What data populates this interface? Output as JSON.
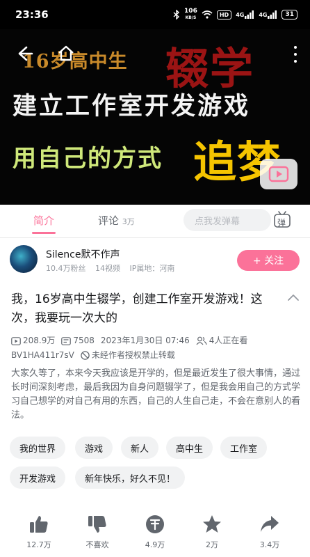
{
  "status_bar": {
    "time": "23:36",
    "net_speed": "106",
    "net_unit": "KB/S",
    "hd_badge": "HD",
    "signal1": "4G",
    "signal2": "4G",
    "battery": "31"
  },
  "video": {
    "line1": "16岁高中生",
    "big1": "辍学",
    "line2": "建立工作室开发游戏",
    "line3": "用自己的方式",
    "big2": "追梦",
    "colors": {
      "gold": "#c98a2a",
      "red": "#9b1414",
      "lime": "#cfe87a",
      "yellow": "#f5c400"
    }
  },
  "tabs": {
    "intro_label": "简介",
    "comments_label": "评论",
    "comments_count": "3万",
    "danmaku_placeholder": "点我发弹幕",
    "danmaku_toggle": "弹",
    "accent_color": "#fb7299"
  },
  "uploader": {
    "name": "Silence默不作声",
    "followers": "10.4万粉丝",
    "videos": "14视频",
    "ip": "IP属地：河南",
    "follow_label": "+ 关注"
  },
  "title": "我，16岁高中生辍学，创建工作室开发游戏！这次，我要玩一次大的",
  "meta": {
    "views": "208.9万",
    "danmaku": "7508",
    "datetime": "2023年1月30日 07:46",
    "watching": "4人正在看",
    "bvid": "BV1HA411r7sV",
    "copyright": "未经作者授权禁止转载"
  },
  "description": "大家久等了，本来今天我应该是开学的，但是最近发生了很大事情，通过长时间深刻考虑，最后我因为自身问题辍学了，但是我会用自己的方式学习自己想学的对自己有用的东西，自己的人生自己走，不会在意别人的看法。",
  "tags": [
    "我的世界",
    "游戏",
    "新人",
    "高中生",
    "工作室",
    "开发游戏",
    "新年快乐，好久不见！"
  ],
  "actions": {
    "like": "12.7万",
    "dislike": "不喜欢",
    "coin": "4.9万",
    "favorite": "2万",
    "share": "3.4万"
  }
}
